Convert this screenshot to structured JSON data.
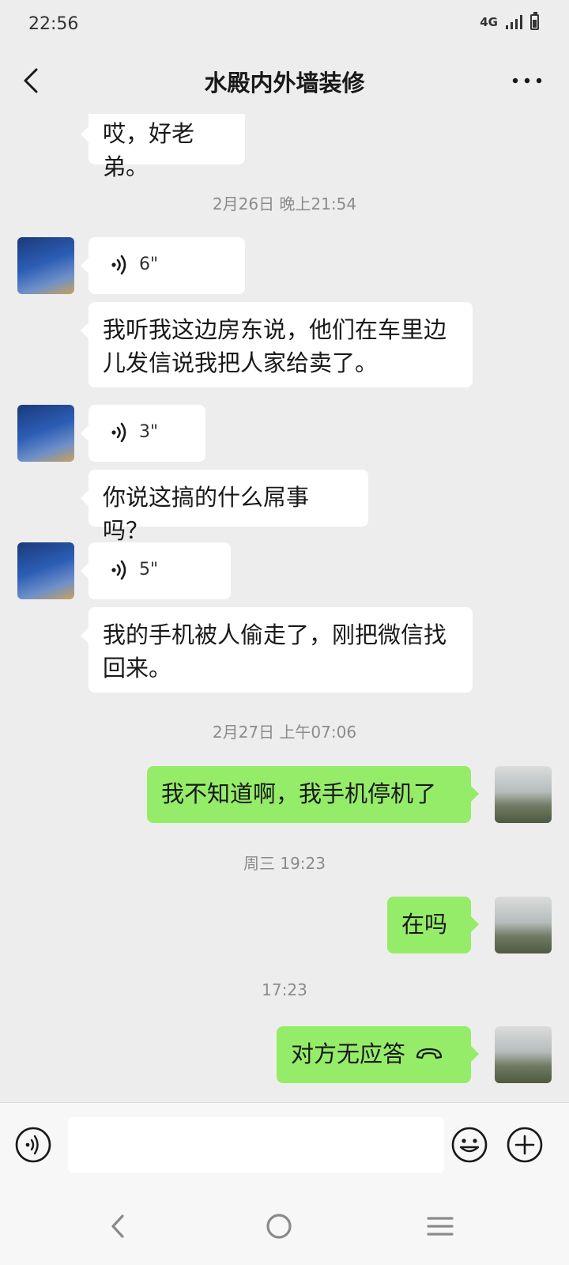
{
  "status_bar": {
    "time": "22:56",
    "network": "4G"
  },
  "header": {
    "title": "水殿内外墙装修"
  },
  "messages": {
    "m0_text": "哎，好老弟。",
    "ts1": "2月26日 晚上21:54",
    "m1_voice": "6\"",
    "m2_text": "我听我这边房东说，他们在车里边儿发信说我把人家给卖了。",
    "m3_voice": "3\"",
    "m4_text": "你说这搞的什么屌事吗？",
    "m5_voice": "5\"",
    "m6_text": "我的手机被人偷走了，刚把微信找回来。",
    "ts2": "2月27日 上午07:06",
    "m7_text": "我不知道啊，我手机停机了",
    "ts3": "周三 19:23",
    "m8_text": "在吗",
    "ts4": "17:23",
    "m9_text": "对方无应答"
  },
  "input": {
    "value": ""
  },
  "colors": {
    "background": "#ededed",
    "sent_bubble": "#95ec69",
    "received_bubble": "#ffffff"
  }
}
